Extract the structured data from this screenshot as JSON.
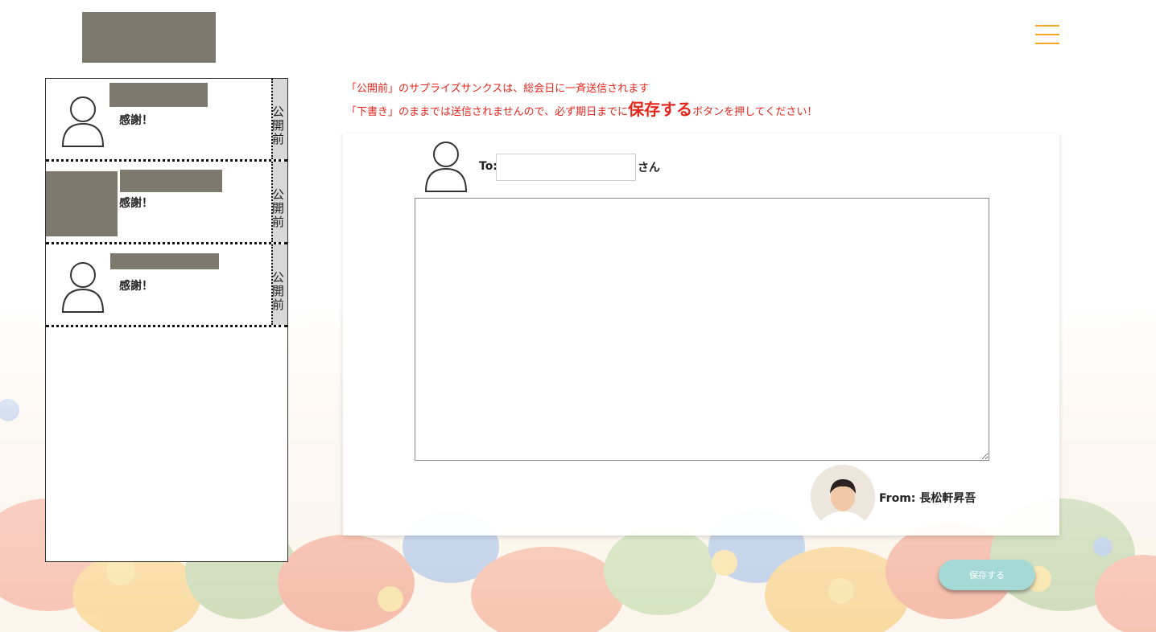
{
  "header": {
    "menu_icon": "hamburger-menu-icon"
  },
  "notices": {
    "line1": "「公開前」のサプライズサンクスは、総会日に一斉送信されます",
    "line2_before": "「下書き」のままでは送信されませんので、必ず期日までに",
    "line2_emphasis": "保存する",
    "line2_after": "ボタンを押してください！"
  },
  "thanks_list": {
    "items": [
      {
        "message": "感謝！",
        "status": "公開前",
        "avatar_icon": "user-outline-icon"
      },
      {
        "message": "感謝！",
        "status": "公開前",
        "avatar_icon": "user-outline-icon"
      },
      {
        "message": "感謝！",
        "status": "公開前",
        "avatar_icon": "user-outline-icon"
      }
    ]
  },
  "compose": {
    "to_label": "To:",
    "to_value": "",
    "to_suffix": "さん",
    "message_value": "",
    "from_label": "From: 長松軒昇吾"
  },
  "actions": {
    "save_label": "保存する"
  },
  "colors": {
    "notice_red": "#e4271d",
    "menu_orange": "#f5a623",
    "save_button_bg": "#a5d9d6",
    "redaction": "#7d7a6d"
  }
}
